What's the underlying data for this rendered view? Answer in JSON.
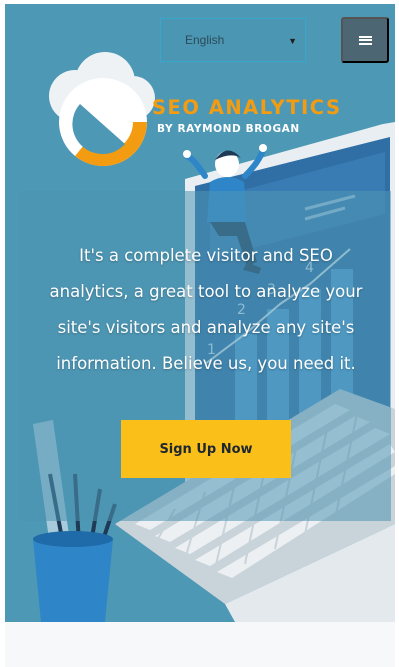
{
  "header": {
    "language_selected": "English",
    "menu_icon": "hamburger-icon"
  },
  "logo": {
    "title": "SEO ANALYTICS",
    "subtitle": "BY RAYMOND BROGAN",
    "icon": "cloud-pie-chart-icon"
  },
  "hero": {
    "tagline": "It's a complete visitor and SEO analytics, a great tool to analyze your site's visitors and analyze any site's information. Believe us, you need it.",
    "cta_label": "Sign Up Now"
  },
  "illustration": {
    "monitor_labels": [
      "1",
      "2",
      "3",
      "4"
    ]
  },
  "colors": {
    "hero_background": "#4d98b4",
    "accent_orange": "#f39c12",
    "cta_yellow": "#fbbf1a",
    "menu_button": "#4d6674"
  }
}
